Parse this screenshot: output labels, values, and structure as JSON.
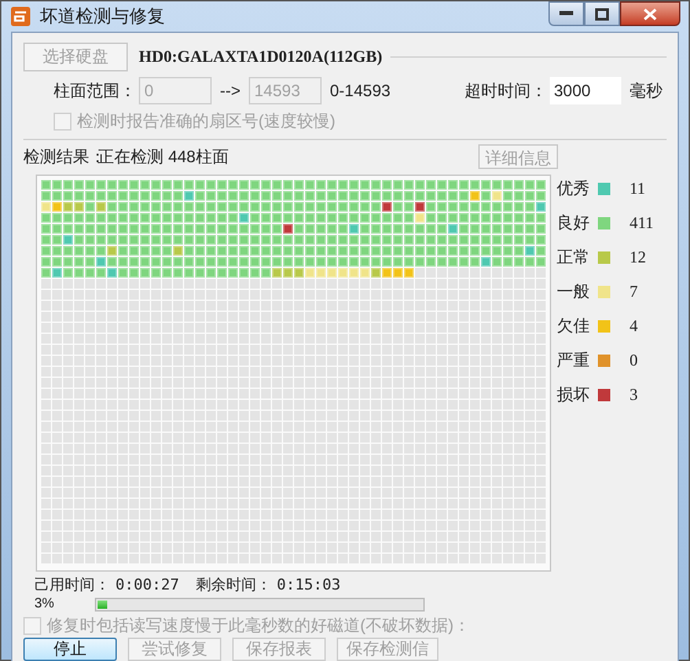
{
  "window": {
    "title": "坏道检测与修复"
  },
  "disk": {
    "select_button": {
      "label": "选择硬盘",
      "disabled": true
    },
    "name": "HD0:GALAXTA1D0120A(112GB)"
  },
  "cylinder_range": {
    "label": "柱面范围：",
    "from": "0",
    "arrow": "-->",
    "to": "14593",
    "disabled": true,
    "range_text": "0-14593"
  },
  "timeout": {
    "label": "超时时间：",
    "value": "3000",
    "unit": "毫秒"
  },
  "report_sector_checkbox": {
    "label": "检测时报告准确的扇区号(速度较慢)",
    "checked": false,
    "disabled": true
  },
  "result": {
    "label": "检测结果：",
    "status": "正在检测 448柱面"
  },
  "details_button": {
    "label": "详细信息",
    "disabled": true
  },
  "grid": {
    "rows": [
      {
        "cells": [
          {
            "kind": "good"
          },
          {
            "kind": "good"
          },
          {
            "kind": "good"
          },
          {
            "kind": "good"
          },
          {
            "kind": "good"
          },
          {
            "kind": "good"
          },
          {
            "kind": "good"
          },
          {
            "kind": "good"
          },
          {
            "kind": "good"
          },
          {
            "kind": "good"
          },
          {
            "kind": "good"
          },
          {
            "kind": "good"
          },
          {
            "kind": "good"
          },
          {
            "kind": "good"
          },
          {
            "kind": "good"
          },
          {
            "kind": "good"
          },
          {
            "kind": "good"
          },
          {
            "kind": "good"
          },
          {
            "kind": "good"
          },
          {
            "kind": "good"
          },
          {
            "kind": "good"
          },
          {
            "kind": "good"
          },
          {
            "kind": "good"
          },
          {
            "kind": "good"
          },
          {
            "kind": "good"
          },
          {
            "kind": "good"
          },
          {
            "kind": "good"
          },
          {
            "kind": "good"
          },
          {
            "kind": "good"
          },
          {
            "kind": "good"
          },
          {
            "kind": "good"
          },
          {
            "kind": "good"
          },
          {
            "kind": "good"
          },
          {
            "kind": "good"
          },
          {
            "kind": "good"
          },
          {
            "kind": "good"
          },
          {
            "kind": "good"
          },
          {
            "kind": "good"
          },
          {
            "kind": "good"
          },
          {
            "kind": "good"
          },
          {
            "kind": "good"
          },
          {
            "kind": "good"
          },
          {
            "kind": "good"
          },
          {
            "kind": "good"
          },
          {
            "kind": "good"
          },
          {
            "kind": "good"
          }
        ]
      },
      {
        "cells": [
          {
            "kind": "good"
          },
          {
            "kind": "good"
          },
          {
            "kind": "good"
          },
          {
            "kind": "good"
          },
          {
            "kind": "good"
          },
          {
            "kind": "good"
          },
          {
            "kind": "good"
          },
          {
            "kind": "good"
          },
          {
            "kind": "good"
          },
          {
            "kind": "good"
          },
          {
            "kind": "good"
          },
          {
            "kind": "good"
          },
          {
            "kind": "good"
          },
          {
            "kind": "top"
          },
          {
            "kind": "good"
          },
          {
            "kind": "good"
          },
          {
            "kind": "good"
          },
          {
            "kind": "good"
          },
          {
            "kind": "good"
          },
          {
            "kind": "good"
          },
          {
            "kind": "good"
          },
          {
            "kind": "good"
          },
          {
            "kind": "good"
          },
          {
            "kind": "good"
          },
          {
            "kind": "good"
          },
          {
            "kind": "good"
          },
          {
            "kind": "good"
          },
          {
            "kind": "good"
          },
          {
            "kind": "good"
          },
          {
            "kind": "good"
          },
          {
            "kind": "good"
          },
          {
            "kind": "good"
          },
          {
            "kind": "good"
          },
          {
            "kind": "good"
          },
          {
            "kind": "good"
          },
          {
            "kind": "good"
          },
          {
            "kind": "good"
          },
          {
            "kind": "good"
          },
          {
            "kind": "good"
          },
          {
            "kind": "poor"
          },
          {
            "kind": "good"
          },
          {
            "kind": "fair"
          },
          {
            "kind": "good"
          },
          {
            "kind": "good"
          },
          {
            "kind": "good"
          },
          {
            "kind": "good"
          }
        ]
      },
      {
        "cells": [
          {
            "kind": "fair"
          },
          {
            "kind": "poor"
          },
          {
            "kind": "ok"
          },
          {
            "kind": "ok"
          },
          {
            "kind": "good"
          },
          {
            "kind": "ok"
          },
          {
            "kind": "good"
          },
          {
            "kind": "good"
          },
          {
            "kind": "good"
          },
          {
            "kind": "good"
          },
          {
            "kind": "good"
          },
          {
            "kind": "good"
          },
          {
            "kind": "good"
          },
          {
            "kind": "good"
          },
          {
            "kind": "good"
          },
          {
            "kind": "good"
          },
          {
            "kind": "good"
          },
          {
            "kind": "good"
          },
          {
            "kind": "good"
          },
          {
            "kind": "good"
          },
          {
            "kind": "good"
          },
          {
            "kind": "good"
          },
          {
            "kind": "good"
          },
          {
            "kind": "good"
          },
          {
            "kind": "good"
          },
          {
            "kind": "good"
          },
          {
            "kind": "good"
          },
          {
            "kind": "good"
          },
          {
            "kind": "good"
          },
          {
            "kind": "good"
          },
          {
            "kind": "good"
          },
          {
            "kind": "bad"
          },
          {
            "kind": "good"
          },
          {
            "kind": "good"
          },
          {
            "kind": "bad"
          },
          {
            "kind": "good"
          },
          {
            "kind": "good"
          },
          {
            "kind": "good"
          },
          {
            "kind": "good"
          },
          {
            "kind": "good"
          },
          {
            "kind": "good"
          },
          {
            "kind": "good"
          },
          {
            "kind": "good"
          },
          {
            "kind": "good"
          },
          {
            "kind": "good"
          },
          {
            "kind": "top"
          }
        ]
      },
      {
        "cells": [
          {
            "kind": "good"
          },
          {
            "kind": "good"
          },
          {
            "kind": "good"
          },
          {
            "kind": "good"
          },
          {
            "kind": "good"
          },
          {
            "kind": "good"
          },
          {
            "kind": "good"
          },
          {
            "kind": "good"
          },
          {
            "kind": "good"
          },
          {
            "kind": "good"
          },
          {
            "kind": "good"
          },
          {
            "kind": "good"
          },
          {
            "kind": "good"
          },
          {
            "kind": "good"
          },
          {
            "kind": "good"
          },
          {
            "kind": "good"
          },
          {
            "kind": "good"
          },
          {
            "kind": "good"
          },
          {
            "kind": "top"
          },
          {
            "kind": "good"
          },
          {
            "kind": "good"
          },
          {
            "kind": "good"
          },
          {
            "kind": "good"
          },
          {
            "kind": "good"
          },
          {
            "kind": "good"
          },
          {
            "kind": "good"
          },
          {
            "kind": "good"
          },
          {
            "kind": "good"
          },
          {
            "kind": "good"
          },
          {
            "kind": "good"
          },
          {
            "kind": "good"
          },
          {
            "kind": "good"
          },
          {
            "kind": "good"
          },
          {
            "kind": "good"
          },
          {
            "kind": "fair"
          },
          {
            "kind": "good"
          },
          {
            "kind": "good"
          },
          {
            "kind": "good"
          },
          {
            "kind": "good"
          },
          {
            "kind": "good"
          },
          {
            "kind": "good"
          },
          {
            "kind": "good"
          },
          {
            "kind": "good"
          },
          {
            "kind": "good"
          },
          {
            "kind": "good"
          },
          {
            "kind": "good"
          }
        ]
      },
      {
        "cells": [
          {
            "kind": "good"
          },
          {
            "kind": "good"
          },
          {
            "kind": "good"
          },
          {
            "kind": "good"
          },
          {
            "kind": "good"
          },
          {
            "kind": "good"
          },
          {
            "kind": "good"
          },
          {
            "kind": "good"
          },
          {
            "kind": "good"
          },
          {
            "kind": "good"
          },
          {
            "kind": "good"
          },
          {
            "kind": "good"
          },
          {
            "kind": "good"
          },
          {
            "kind": "good"
          },
          {
            "kind": "good"
          },
          {
            "kind": "good"
          },
          {
            "kind": "good"
          },
          {
            "kind": "good"
          },
          {
            "kind": "good"
          },
          {
            "kind": "good"
          },
          {
            "kind": "good"
          },
          {
            "kind": "good"
          },
          {
            "kind": "bad"
          },
          {
            "kind": "good"
          },
          {
            "kind": "good"
          },
          {
            "kind": "good"
          },
          {
            "kind": "good"
          },
          {
            "kind": "good"
          },
          {
            "kind": "top"
          },
          {
            "kind": "good"
          },
          {
            "kind": "good"
          },
          {
            "kind": "good"
          },
          {
            "kind": "good"
          },
          {
            "kind": "good"
          },
          {
            "kind": "good"
          },
          {
            "kind": "good"
          },
          {
            "kind": "good"
          },
          {
            "kind": "top"
          },
          {
            "kind": "good"
          },
          {
            "kind": "good"
          },
          {
            "kind": "good"
          },
          {
            "kind": "good"
          },
          {
            "kind": "good"
          },
          {
            "kind": "good"
          },
          {
            "kind": "good"
          },
          {
            "kind": "good"
          }
        ]
      },
      {
        "cells": [
          {
            "kind": "good"
          },
          {
            "kind": "good"
          },
          {
            "kind": "top"
          },
          {
            "kind": "good"
          },
          {
            "kind": "good"
          },
          {
            "kind": "good"
          },
          {
            "kind": "good"
          },
          {
            "kind": "good"
          },
          {
            "kind": "good"
          },
          {
            "kind": "good"
          },
          {
            "kind": "good"
          },
          {
            "kind": "good"
          },
          {
            "kind": "good"
          },
          {
            "kind": "good"
          },
          {
            "kind": "good"
          },
          {
            "kind": "good"
          },
          {
            "kind": "good"
          },
          {
            "kind": "good"
          },
          {
            "kind": "good"
          },
          {
            "kind": "good"
          },
          {
            "kind": "good"
          },
          {
            "kind": "good"
          },
          {
            "kind": "good"
          },
          {
            "kind": "good"
          },
          {
            "kind": "good"
          },
          {
            "kind": "good"
          },
          {
            "kind": "good"
          },
          {
            "kind": "good"
          },
          {
            "kind": "good"
          },
          {
            "kind": "good"
          },
          {
            "kind": "good"
          },
          {
            "kind": "good"
          },
          {
            "kind": "good"
          },
          {
            "kind": "good"
          },
          {
            "kind": "good"
          },
          {
            "kind": "good"
          },
          {
            "kind": "good"
          },
          {
            "kind": "good"
          },
          {
            "kind": "good"
          },
          {
            "kind": "good"
          },
          {
            "kind": "good"
          },
          {
            "kind": "good"
          },
          {
            "kind": "good"
          },
          {
            "kind": "good"
          },
          {
            "kind": "good"
          },
          {
            "kind": "good"
          }
        ]
      },
      {
        "cells": [
          {
            "kind": "good"
          },
          {
            "kind": "good"
          },
          {
            "kind": "good"
          },
          {
            "kind": "good"
          },
          {
            "kind": "good"
          },
          {
            "kind": "good"
          },
          {
            "kind": "ok"
          },
          {
            "kind": "good"
          },
          {
            "kind": "good"
          },
          {
            "kind": "good"
          },
          {
            "kind": "good"
          },
          {
            "kind": "good"
          },
          {
            "kind": "ok"
          },
          {
            "kind": "good"
          },
          {
            "kind": "good"
          },
          {
            "kind": "good"
          },
          {
            "kind": "good"
          },
          {
            "kind": "good"
          },
          {
            "kind": "good"
          },
          {
            "kind": "good"
          },
          {
            "kind": "good"
          },
          {
            "kind": "good"
          },
          {
            "kind": "good"
          },
          {
            "kind": "good"
          },
          {
            "kind": "good"
          },
          {
            "kind": "good"
          },
          {
            "kind": "good"
          },
          {
            "kind": "good"
          },
          {
            "kind": "good"
          },
          {
            "kind": "good"
          },
          {
            "kind": "good"
          },
          {
            "kind": "good"
          },
          {
            "kind": "good"
          },
          {
            "kind": "good"
          },
          {
            "kind": "good"
          },
          {
            "kind": "good"
          },
          {
            "kind": "good"
          },
          {
            "kind": "good"
          },
          {
            "kind": "good"
          },
          {
            "kind": "good"
          },
          {
            "kind": "good"
          },
          {
            "kind": "good"
          },
          {
            "kind": "good"
          },
          {
            "kind": "good"
          },
          {
            "kind": "top"
          },
          {
            "kind": "good"
          }
        ]
      },
      {
        "cells": [
          {
            "kind": "good"
          },
          {
            "kind": "good"
          },
          {
            "kind": "good"
          },
          {
            "kind": "good"
          },
          {
            "kind": "good"
          },
          {
            "kind": "top"
          },
          {
            "kind": "good"
          },
          {
            "kind": "good"
          },
          {
            "kind": "good"
          },
          {
            "kind": "good"
          },
          {
            "kind": "good"
          },
          {
            "kind": "good"
          },
          {
            "kind": "good"
          },
          {
            "kind": "good"
          },
          {
            "kind": "good"
          },
          {
            "kind": "good"
          },
          {
            "kind": "good"
          },
          {
            "kind": "good"
          },
          {
            "kind": "good"
          },
          {
            "kind": "good"
          },
          {
            "kind": "good"
          },
          {
            "kind": "good"
          },
          {
            "kind": "good"
          },
          {
            "kind": "good"
          },
          {
            "kind": "good"
          },
          {
            "kind": "good"
          },
          {
            "kind": "good"
          },
          {
            "kind": "good"
          },
          {
            "kind": "good"
          },
          {
            "kind": "good"
          },
          {
            "kind": "good"
          },
          {
            "kind": "good"
          },
          {
            "kind": "good"
          },
          {
            "kind": "good"
          },
          {
            "kind": "good"
          },
          {
            "kind": "good"
          },
          {
            "kind": "good"
          },
          {
            "kind": "good"
          },
          {
            "kind": "good"
          },
          {
            "kind": "good"
          },
          {
            "kind": "top"
          },
          {
            "kind": "good"
          },
          {
            "kind": "good"
          },
          {
            "kind": "good"
          },
          {
            "kind": "good"
          },
          {
            "kind": "good"
          }
        ]
      },
      {
        "cells": [
          {
            "kind": "good"
          },
          {
            "kind": "top"
          },
          {
            "kind": "good"
          },
          {
            "kind": "good"
          },
          {
            "kind": "good"
          },
          {
            "kind": "good"
          },
          {
            "kind": "top"
          },
          {
            "kind": "good"
          },
          {
            "kind": "good"
          },
          {
            "kind": "good"
          },
          {
            "kind": "good"
          },
          {
            "kind": "good"
          },
          {
            "kind": "good"
          },
          {
            "kind": "good"
          },
          {
            "kind": "good"
          },
          {
            "kind": "good"
          },
          {
            "kind": "good"
          },
          {
            "kind": "good"
          },
          {
            "kind": "good"
          },
          {
            "kind": "good"
          },
          {
            "kind": "good"
          },
          {
            "kind": "ok"
          },
          {
            "kind": "ok"
          },
          {
            "kind": "ok"
          },
          {
            "kind": "fair"
          },
          {
            "kind": "fair"
          },
          {
            "kind": "fair"
          },
          {
            "kind": "fair"
          },
          {
            "kind": "fair"
          },
          {
            "kind": "fair"
          },
          {
            "kind": "ok"
          },
          {
            "kind": "poor"
          },
          {
            "kind": "poor"
          },
          {
            "kind": "poor"
          },
          {
            "kind": "none"
          },
          {
            "kind": "none"
          },
          {
            "kind": "none"
          },
          {
            "kind": "none"
          },
          {
            "kind": "none"
          },
          {
            "kind": "none"
          },
          {
            "kind": "none"
          },
          {
            "kind": "none"
          },
          {
            "kind": "none"
          },
          {
            "kind": "none"
          },
          {
            "kind": "none"
          },
          {
            "kind": "none"
          }
        ]
      }
    ]
  },
  "legend": [
    {
      "kind": "top",
      "label": "优秀",
      "color": "#4fc9b0",
      "count": "11"
    },
    {
      "kind": "good",
      "label": "良好",
      "color": "#7fd67f",
      "count": "411"
    },
    {
      "kind": "ok",
      "label": "正常",
      "color": "#b8c94a",
      "count": "12"
    },
    {
      "kind": "fair",
      "label": "一般",
      "color": "#f0e48a",
      "count": "7"
    },
    {
      "kind": "poor",
      "label": "欠佳",
      "color": "#f2c318",
      "count": "4"
    },
    {
      "kind": "grave",
      "label": "严重",
      "color": "#e0922a",
      "count": "0"
    },
    {
      "kind": "bad",
      "label": "损坏",
      "color": "#c0393b",
      "count": "3"
    }
  ],
  "time": {
    "elapsed_label": "己用时间：",
    "elapsed": "0:00:27",
    "remaining_label": "剩余时间：",
    "remaining": "0:15:03"
  },
  "progress": {
    "text": "3%",
    "level": 0.03
  },
  "repair_slow_checkbox": {
    "label": "修复时包括读写速度慢于此毫秒数的好磁道(不破坏数据)：",
    "checked": false,
    "disabled": true
  },
  "buttons": [
    {
      "label": "停止",
      "disabled": false
    },
    {
      "label": "尝试修复",
      "disabled": true
    },
    {
      "label": "保存报表",
      "disabled": true
    },
    {
      "label": "保存检测信",
      "disabled": true
    }
  ]
}
